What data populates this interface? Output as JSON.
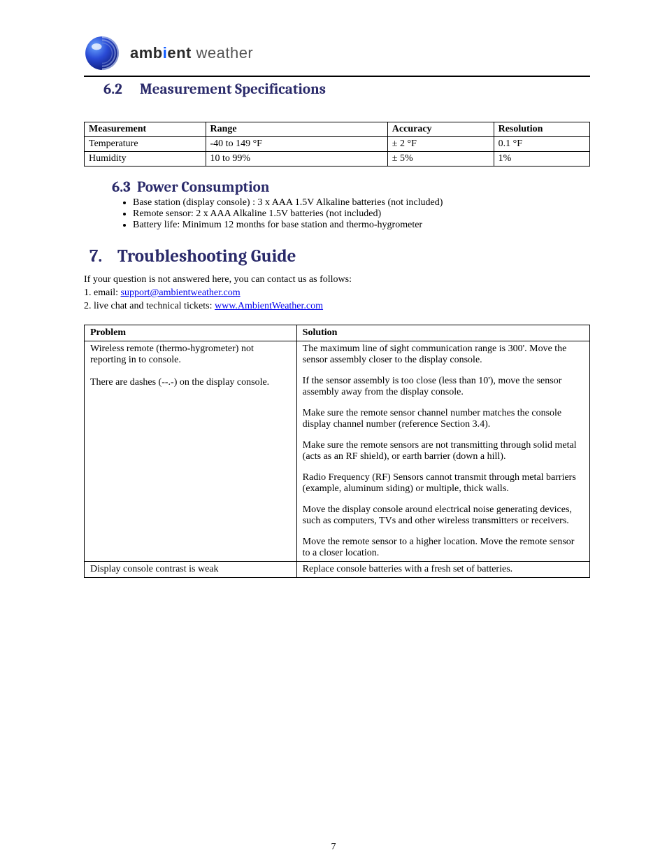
{
  "brand": {
    "part1": "amb",
    "accent": "i",
    "part2": "ent",
    "part3": " weather"
  },
  "section62": {
    "num": "6.2",
    "title": "Measurement Specifications",
    "headers": [
      "Measurement",
      "Range",
      "Accuracy",
      "Resolution"
    ],
    "rows": [
      [
        "Temperature",
        "-40 to 149 °F",
        "± 2 °F",
        "0.1 °F"
      ],
      [
        "Humidity",
        "10 to 99%",
        "± 5%",
        "1%"
      ]
    ]
  },
  "section63": {
    "num": "6.3",
    "title": "Power Consumption",
    "items": [
      "Base station (display console) : 3 x AAA 1.5V Alkaline batteries (not included)",
      "Remote sensor:  2 x AAA Alkaline 1.5V batteries (not included)",
      "Battery life: Minimum 12 months for base station and thermo-hygrometer"
    ]
  },
  "section7": {
    "num": "7.",
    "title": "Troubleshooting Guide",
    "note_pre": "If your question is not answered here, you can contact us as follows:",
    "note_items": [
      {
        "label": "email: ",
        "link_text": "support@ambientweather.com"
      },
      {
        "label": "live chat and technical tickets: ",
        "link_text": "www.AmbientWeather.com"
      }
    ],
    "col_problem": "Problem",
    "col_solution": "Solution",
    "rows": [
      {
        "problem": "Wireless remote (thermo-hygrometer) not reporting in to console.\n\nThere are dashes (--.-) on the display console.",
        "solution": [
          "The maximum line of sight communication range is 300'. Move the sensor assembly closer to the display console.",
          "If the sensor assembly is too close (less than 10'), move the sensor assembly away from the display console.",
          "Make sure the remote sensor channel number matches the console display channel number (reference Section 3.4).",
          "Make sure the remote sensors are not transmitting through solid metal (acts as an RF shield), or earth barrier (down a hill).",
          "Radio Frequency (RF) Sensors cannot transmit through metal barriers (example, aluminum siding) or multiple, thick walls.",
          "Move the display console around electrical noise generating devices, such as computers, TVs and other wireless transmitters or receivers.",
          "Move the remote sensor to a higher location. Move the remote sensor to a closer location."
        ]
      },
      {
        "problem": "Display console contrast is weak",
        "solution": [
          "Replace console batteries with a fresh set of batteries."
        ]
      }
    ]
  },
  "page_number": "7"
}
